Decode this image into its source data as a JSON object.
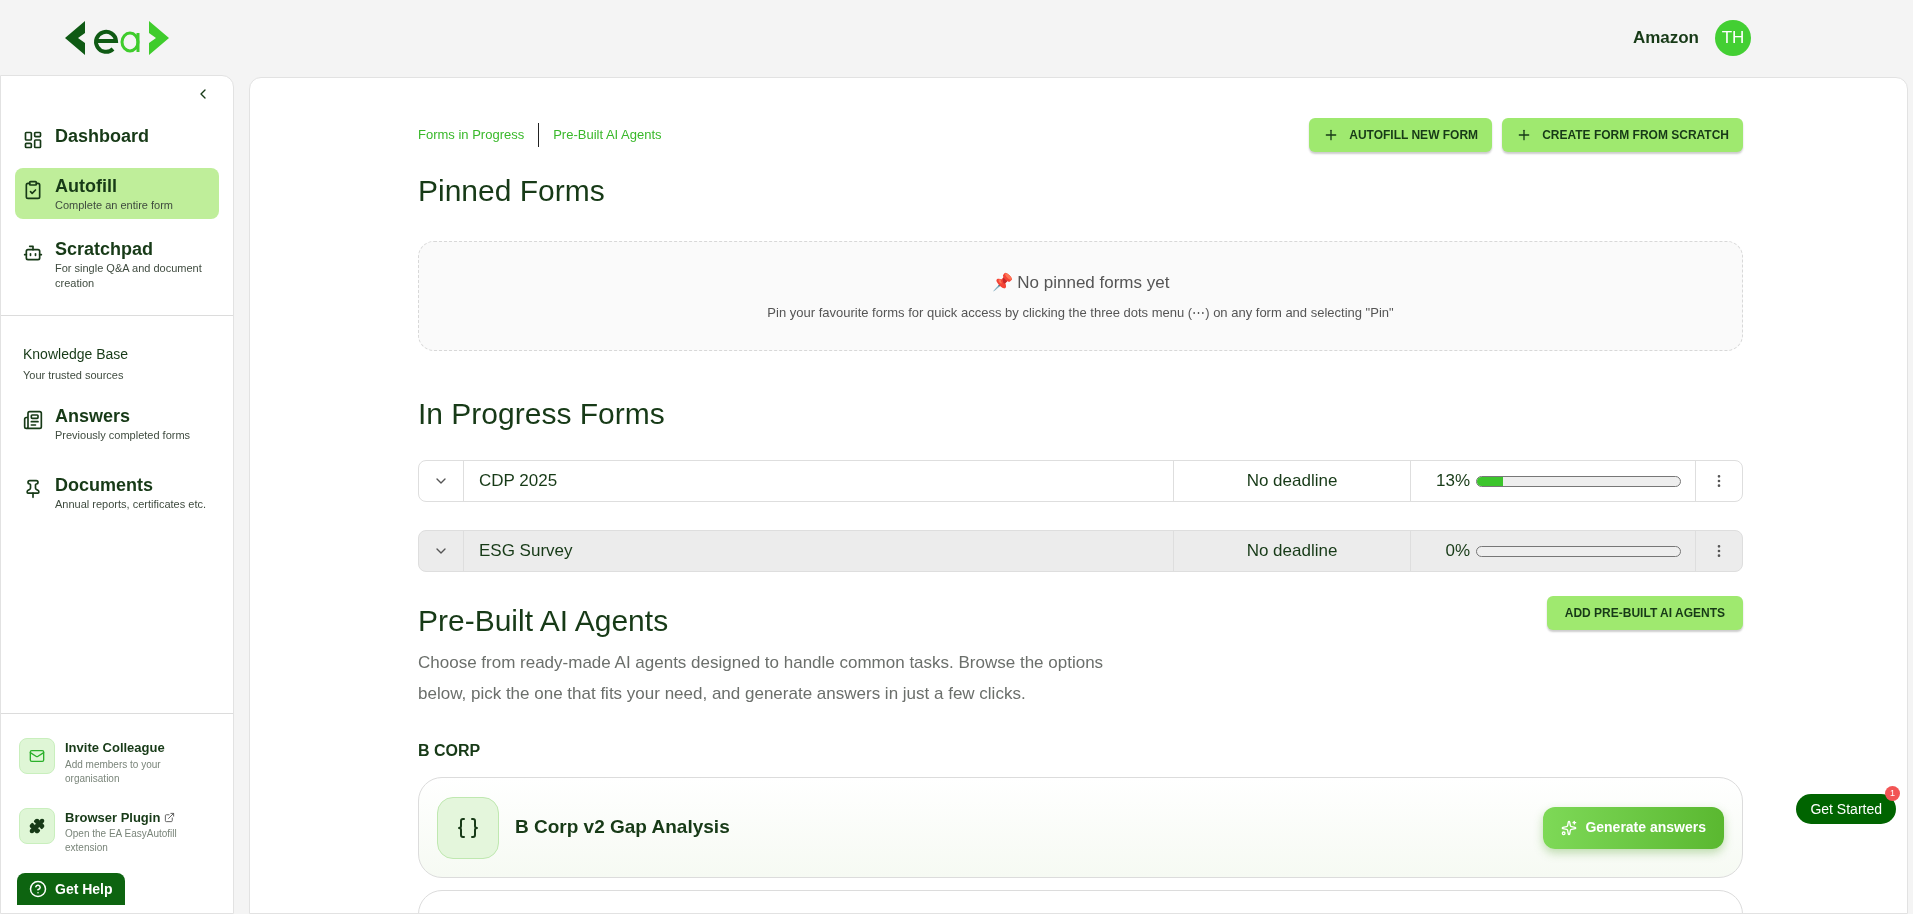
{
  "header": {
    "organisation": "Amazon",
    "avatar_initials": "TH"
  },
  "sidebar": {
    "main_items": [
      {
        "kind": "dashboard",
        "label": "Dashboard",
        "selected": false
      },
      {
        "kind": "autofill",
        "label": "Autofill",
        "subtitle": "Complete an entire form",
        "selected": true
      },
      {
        "kind": "scratchpad",
        "label": "Scratchpad",
        "subtitle": "For single Q&A and document creation",
        "selected": false
      }
    ],
    "section": {
      "title": "Knowledge Base",
      "subtitle": "Your trusted sources"
    },
    "kb_items": [
      {
        "kind": "answers",
        "label": "Answers",
        "subtitle": "Previously completed forms",
        "selected": false
      },
      {
        "kind": "documents",
        "label": "Documents",
        "subtitle": "Annual reports, certificates etc.",
        "selected": false
      }
    ],
    "footer_items": [
      {
        "kind": "invite",
        "label": "Invite Colleague",
        "subtitle": "Add members to your organisation",
        "external": false
      },
      {
        "kind": "plugin",
        "label": "Browser Plugin",
        "subtitle": "Open the EA EasyAutofill extension",
        "external": true
      }
    ],
    "help_button": "Get Help"
  },
  "main": {
    "nav_links": [
      "Forms in Progress",
      "Pre-Built AI Agents"
    ],
    "actions": [
      "AUTOFILL NEW FORM",
      "CREATE FORM FROM SCRATCH"
    ],
    "pinned": {
      "title": "Pinned Forms",
      "empty_icon": "📌",
      "empty_title": "No pinned forms yet",
      "empty_hint": "Pin your favourite forms for quick access by clicking the three dots menu (⋯) on any form and selecting \"Pin\""
    },
    "in_progress": {
      "title": "In Progress Forms",
      "rows": [
        {
          "name": "CDP 2025",
          "deadline": "No deadline",
          "percent": "13%",
          "level": 0.13,
          "highlighted": false
        },
        {
          "name": "ESG Survey",
          "deadline": "No deadline",
          "percent": "0%",
          "level": 0,
          "highlighted": true
        }
      ]
    },
    "agents": {
      "title": "Pre-Built AI Agents",
      "add_button": "ADD PRE-BUILT AI AGENTS",
      "description": "Choose from ready-made AI agents designed to handle common tasks. Browse the options below, pick the one that fits your need, and generate answers in just a few clicks.",
      "groups": [
        {
          "title": "B CORP",
          "cards": [
            {
              "title": "B Corp v2 Gap Analysis",
              "button": "Generate answers"
            }
          ]
        }
      ]
    }
  },
  "get_started": {
    "label": "Get Started",
    "badge": "1"
  }
}
